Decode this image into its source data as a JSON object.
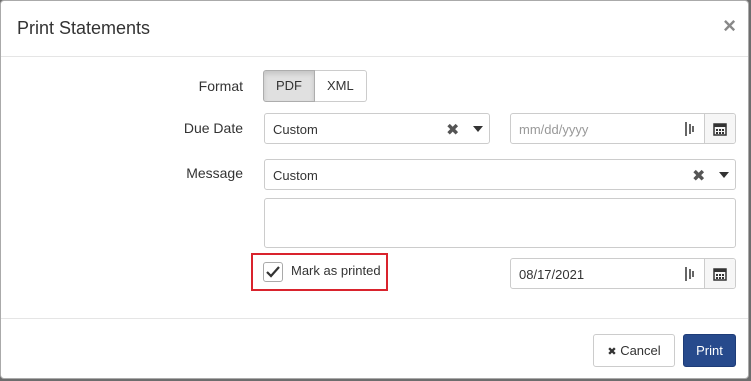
{
  "dialog": {
    "title": "Print Statements",
    "close_glyph": "×"
  },
  "form": {
    "format_label": "Format",
    "format_options": [
      "PDF",
      "XML"
    ],
    "format_selected": "PDF",
    "due_date_label": "Due Date",
    "due_date_select_value": "Custom",
    "due_date_placeholder": "mm/dd/yyyy",
    "message_label": "Message",
    "message_select_value": "Custom",
    "message_text": "",
    "mark_printed_label": "Mark as printed",
    "mark_printed_checked": true,
    "printed_date_value": "08/17/2021"
  },
  "footer": {
    "cancel_label": "Cancel",
    "print_label": "Print"
  },
  "colors": {
    "primary": "#274a8c",
    "highlight": "#d9232d"
  },
  "icons": {
    "close": "close-icon",
    "clear": "clear-icon",
    "caret": "chevron-down-icon",
    "calendar": "calendar-icon",
    "check": "check-icon",
    "cancel_x": "x-icon"
  }
}
